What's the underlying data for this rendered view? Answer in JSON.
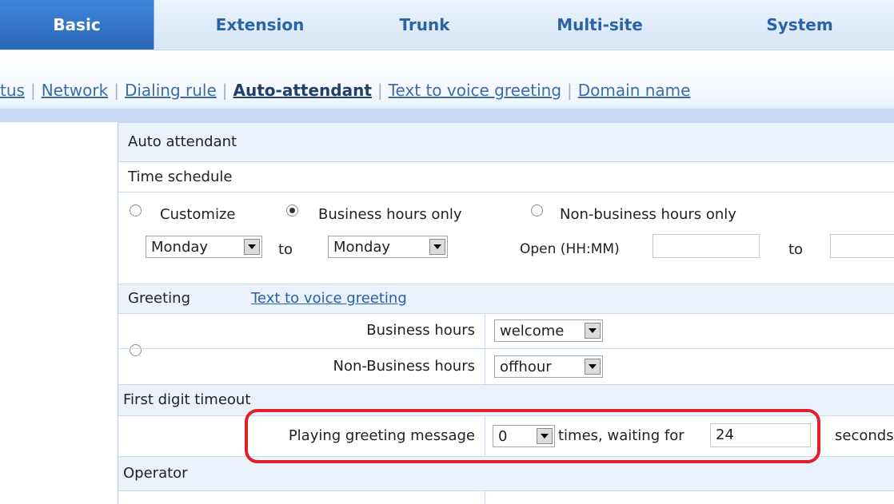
{
  "top_tabs": [
    "Basic",
    "Extension",
    "Trunk",
    "Multi-site",
    "System"
  ],
  "subnav": {
    "items": [
      "tus",
      "Network",
      "Dialing rule",
      "Auto-attendant",
      "Text to voice greeting",
      "Domain name"
    ]
  },
  "panel": {
    "title": "Auto attendant",
    "time_schedule_label": "Time schedule",
    "schedule_options": {
      "customize": "Customize",
      "business_hours_only": "Business hours only",
      "non_business_hours_only": "Non-business hours only"
    },
    "day_from": "Monday",
    "to_label_1": "to",
    "day_to": "Monday",
    "open_label": "Open (HH:MM)",
    "open_value": "",
    "to_label_2": "to",
    "close_value": "",
    "greeting_label": "Greeting",
    "greeting_link": "Text to voice greeting",
    "business_hours_label": "Business hours",
    "business_hours_value": "welcome",
    "non_business_hours_label": "Non-Business hours",
    "non_business_hours_value": "offhour",
    "first_digit_timeout_label": "First digit timeout",
    "playing_greeting_label": "Playing greeting message",
    "playing_greeting_times": "0",
    "times_waiting_label": "times, waiting for",
    "waiting_seconds": "24",
    "seconds_label": "seconds",
    "operator_label": "Operator"
  },
  "colors": {
    "active_tab": "#3f86d8",
    "highlight": "#e0202a",
    "link": "#2a5fa8"
  }
}
